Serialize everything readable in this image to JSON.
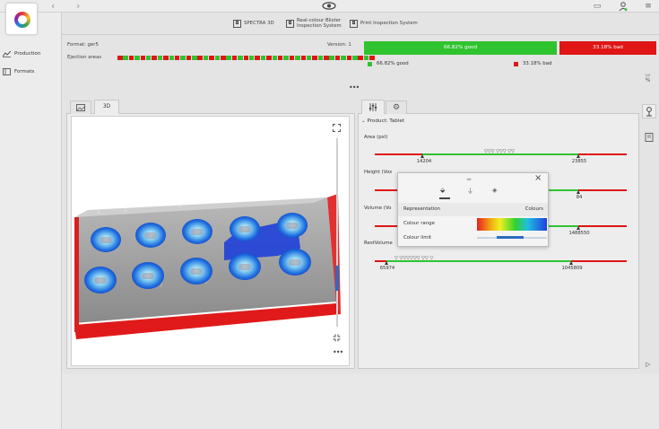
{
  "topbar": {
    "back_icon": "chevron-left-icon",
    "forward_icon": "chevron-right-icon",
    "center_icon": "eye-icon",
    "help_icon": "help-book-icon",
    "user_icon": "user-icon",
    "menu_icon": "hamburger-menu-icon"
  },
  "systems": [
    {
      "label": "SPECTRA 3D",
      "icon": "3d-camera-icon"
    },
    {
      "label": "Real-colour Blister Inspection System",
      "icon": "camera-icon"
    },
    {
      "label": "Print Inspection System",
      "icon": "print-camera-icon"
    }
  ],
  "sidebar": {
    "items": [
      {
        "label": "Production",
        "icon": "chart-icon"
      },
      {
        "label": "Formats",
        "icon": "formats-icon"
      }
    ]
  },
  "format": {
    "format_text": "Format: ger5",
    "version_text": "Version: 1",
    "ejection_label": "Ejection areas",
    "ejection_states": [
      "r",
      "g",
      "r",
      "g",
      "r",
      "g",
      "r",
      "g",
      "r",
      "g",
      "r",
      "g",
      "r",
      "g",
      "r",
      "g",
      "r",
      "g",
      "r",
      "g",
      "r",
      "g",
      "r",
      "g",
      "r",
      "g",
      "r",
      "g",
      "r",
      "g",
      "r",
      "g",
      "r",
      "g",
      "r",
      "g",
      "r",
      "g",
      "r",
      "g",
      "r",
      "g",
      "r",
      "g",
      "r"
    ]
  },
  "stats": {
    "good_label": "66.82% good",
    "bad_label": "33.18% bad",
    "good_fraction": 0.6682,
    "good_color": "#2fc42f",
    "bad_color": "#e01515",
    "legend_good": "66.82% good",
    "legend_bad": "33.18% bad"
  },
  "viewer": {
    "tabs": [
      {
        "label": "",
        "icon": "image-icon"
      },
      {
        "label": "3D",
        "icon": ""
      }
    ],
    "active_tab": "3D",
    "fullscreen_icon": "expand-icon",
    "fit_icon": "fit-icon",
    "more_icon": "more-dots-icon"
  },
  "params": {
    "tabs": [
      {
        "icon": "sliders-icon"
      },
      {
        "icon": "gear-icon"
      }
    ],
    "product_label": "Product: Tablet",
    "metrics": [
      {
        "label": "Area (pxl)",
        "min_label": "14204",
        "max_label": "23855"
      },
      {
        "label": "Height (Vox",
        "min_label": "",
        "max_label": "84"
      },
      {
        "label": "Volume (Vo",
        "min_label": "",
        "max_label": "1488550"
      },
      {
        "label": "RestVolume",
        "min_label": "65974",
        "max_label": "1045809"
      }
    ]
  },
  "popup": {
    "drag_icon": "drag-handle-icon",
    "close_icon": "close-icon",
    "tab_icons": [
      "colour-fill-icon",
      "filter-icon",
      "layers-icon"
    ],
    "rows": [
      {
        "label": "Representation",
        "value": "Colours"
      },
      {
        "label": "Colour range",
        "value": ""
      },
      {
        "label": "Colour limit",
        "value": ""
      }
    ]
  }
}
